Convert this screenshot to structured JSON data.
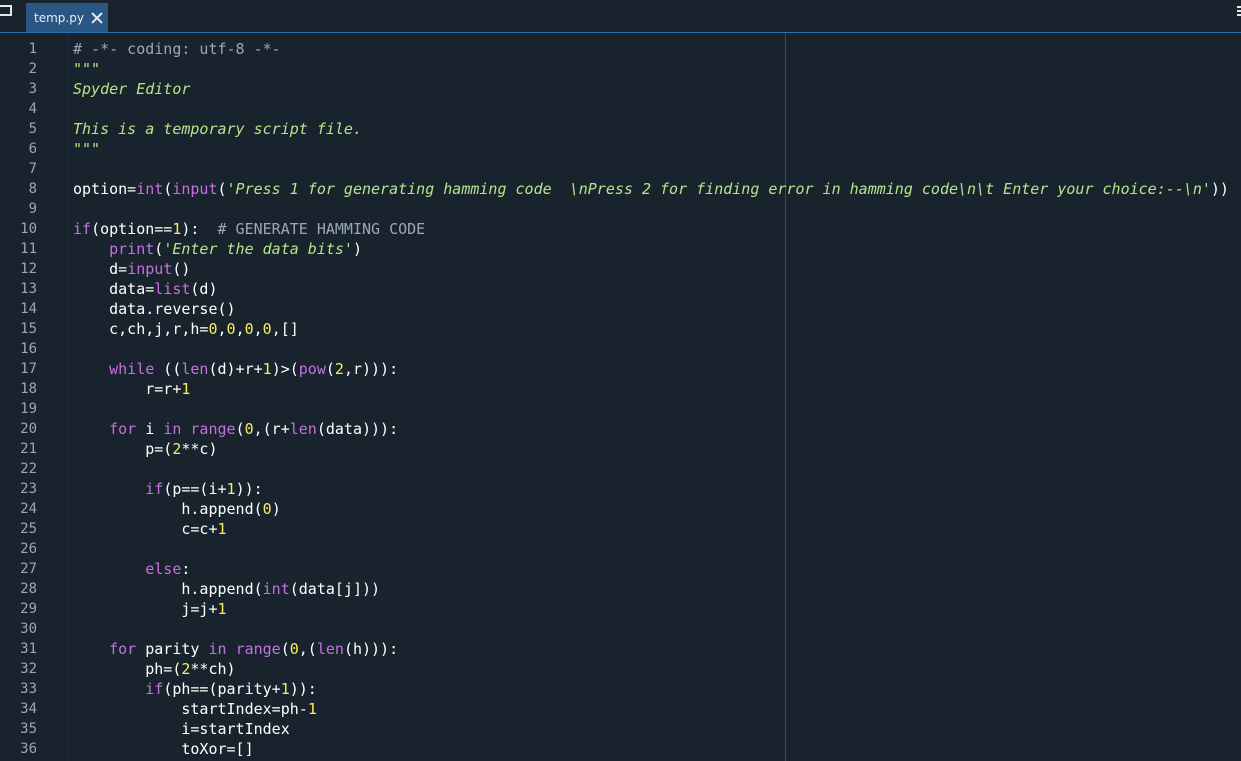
{
  "tab": {
    "filename": "temp.py"
  },
  "icons": {
    "close": "close-icon",
    "browse_tabs": "browse-tabs-icon",
    "options": "options-menu-icon"
  },
  "colors": {
    "background": "#19232d",
    "tab_active": "#2a5684",
    "accent_line": "#2a6fb0",
    "comment": "#9aa8b5",
    "string": "#b5e58c",
    "keyword": "#c670e0",
    "number": "#faed5c",
    "text": "#ffffff"
  },
  "lines": [
    {
      "n": "1",
      "tokens": [
        [
          "comment",
          "# -*- coding: utf-8 -*-"
        ]
      ]
    },
    {
      "n": "2",
      "tokens": [
        [
          "string",
          "\"\"\""
        ]
      ]
    },
    {
      "n": "3",
      "tokens": [
        [
          "string",
          "Spyder Editor"
        ]
      ]
    },
    {
      "n": "4",
      "tokens": []
    },
    {
      "n": "5",
      "tokens": [
        [
          "string",
          "This is a temporary script file."
        ]
      ]
    },
    {
      "n": "6",
      "tokens": [
        [
          "string",
          "\"\"\""
        ]
      ]
    },
    {
      "n": "7",
      "tokens": []
    },
    {
      "n": "8",
      "tokens": [
        [
          "plain",
          "option="
        ],
        [
          "builtin",
          "int"
        ],
        [
          "plain",
          "("
        ],
        [
          "builtin",
          "input"
        ],
        [
          "plain",
          "("
        ],
        [
          "string",
          "'Press 1 for generating hamming code  \\nPress 2 for finding error in hamming code\\n\\t Enter your choice:--\\n'"
        ],
        [
          "plain",
          "))"
        ]
      ]
    },
    {
      "n": "9",
      "tokens": []
    },
    {
      "n": "10",
      "tokens": [
        [
          "keyword",
          "if"
        ],
        [
          "plain",
          "(option=="
        ],
        [
          "number",
          "1"
        ],
        [
          "plain",
          "):  "
        ],
        [
          "comment",
          "# GENERATE HAMMING CODE"
        ]
      ]
    },
    {
      "n": "11",
      "tokens": [
        [
          "plain",
          "    "
        ],
        [
          "builtin",
          "print"
        ],
        [
          "plain",
          "("
        ],
        [
          "string",
          "'Enter the data bits'"
        ],
        [
          "plain",
          ")"
        ]
      ]
    },
    {
      "n": "12",
      "tokens": [
        [
          "plain",
          "    d="
        ],
        [
          "builtin",
          "input"
        ],
        [
          "plain",
          "()"
        ]
      ]
    },
    {
      "n": "13",
      "tokens": [
        [
          "plain",
          "    data="
        ],
        [
          "builtin",
          "list"
        ],
        [
          "plain",
          "(d)"
        ]
      ]
    },
    {
      "n": "14",
      "tokens": [
        [
          "plain",
          "    data.reverse()"
        ]
      ]
    },
    {
      "n": "15",
      "tokens": [
        [
          "plain",
          "    c,ch,j,r,h="
        ],
        [
          "number",
          "0"
        ],
        [
          "plain",
          ","
        ],
        [
          "number",
          "0"
        ],
        [
          "plain",
          ","
        ],
        [
          "number",
          "0"
        ],
        [
          "plain",
          ","
        ],
        [
          "number",
          "0"
        ],
        [
          "plain",
          ",[]"
        ]
      ]
    },
    {
      "n": "16",
      "tokens": []
    },
    {
      "n": "17",
      "tokens": [
        [
          "plain",
          "    "
        ],
        [
          "keyword",
          "while"
        ],
        [
          "plain",
          " (("
        ],
        [
          "builtin",
          "len"
        ],
        [
          "plain",
          "(d)+r+"
        ],
        [
          "number",
          "1"
        ],
        [
          "plain",
          ")>("
        ],
        [
          "builtin",
          "pow"
        ],
        [
          "plain",
          "("
        ],
        [
          "number",
          "2"
        ],
        [
          "plain",
          ",r))):"
        ]
      ]
    },
    {
      "n": "18",
      "tokens": [
        [
          "plain",
          "        r=r+"
        ],
        [
          "number",
          "1"
        ]
      ]
    },
    {
      "n": "19",
      "tokens": []
    },
    {
      "n": "20",
      "tokens": [
        [
          "plain",
          "    "
        ],
        [
          "keyword",
          "for"
        ],
        [
          "plain",
          " i "
        ],
        [
          "keyword",
          "in"
        ],
        [
          "plain",
          " "
        ],
        [
          "builtin",
          "range"
        ],
        [
          "plain",
          "("
        ],
        [
          "number",
          "0"
        ],
        [
          "plain",
          ",(r+"
        ],
        [
          "builtin",
          "len"
        ],
        [
          "plain",
          "(data))):"
        ]
      ]
    },
    {
      "n": "21",
      "tokens": [
        [
          "plain",
          "        p=("
        ],
        [
          "number",
          "2"
        ],
        [
          "plain",
          "**c)"
        ]
      ]
    },
    {
      "n": "22",
      "tokens": []
    },
    {
      "n": "23",
      "tokens": [
        [
          "plain",
          "        "
        ],
        [
          "keyword",
          "if"
        ],
        [
          "plain",
          "(p==(i+"
        ],
        [
          "number",
          "1"
        ],
        [
          "plain",
          ")):"
        ]
      ]
    },
    {
      "n": "24",
      "tokens": [
        [
          "plain",
          "            h.append("
        ],
        [
          "number",
          "0"
        ],
        [
          "plain",
          ")"
        ]
      ]
    },
    {
      "n": "25",
      "tokens": [
        [
          "plain",
          "            c=c+"
        ],
        [
          "number",
          "1"
        ]
      ]
    },
    {
      "n": "26",
      "tokens": []
    },
    {
      "n": "27",
      "tokens": [
        [
          "plain",
          "        "
        ],
        [
          "keyword",
          "else"
        ],
        [
          "plain",
          ":"
        ]
      ]
    },
    {
      "n": "28",
      "tokens": [
        [
          "plain",
          "            h.append("
        ],
        [
          "builtin",
          "int"
        ],
        [
          "plain",
          "(data[j]))"
        ]
      ]
    },
    {
      "n": "29",
      "tokens": [
        [
          "plain",
          "            j=j+"
        ],
        [
          "number",
          "1"
        ]
      ]
    },
    {
      "n": "30",
      "tokens": []
    },
    {
      "n": "31",
      "tokens": [
        [
          "plain",
          "    "
        ],
        [
          "keyword",
          "for"
        ],
        [
          "plain",
          " parity "
        ],
        [
          "keyword",
          "in"
        ],
        [
          "plain",
          " "
        ],
        [
          "builtin",
          "range"
        ],
        [
          "plain",
          "("
        ],
        [
          "number",
          "0"
        ],
        [
          "plain",
          ",("
        ],
        [
          "builtin",
          "len"
        ],
        [
          "plain",
          "(h))):"
        ]
      ]
    },
    {
      "n": "32",
      "tokens": [
        [
          "plain",
          "        ph=("
        ],
        [
          "number",
          "2"
        ],
        [
          "plain",
          "**ch)"
        ]
      ]
    },
    {
      "n": "33",
      "tokens": [
        [
          "plain",
          "        "
        ],
        [
          "keyword",
          "if"
        ],
        [
          "plain",
          "(ph==(parity+"
        ],
        [
          "number",
          "1"
        ],
        [
          "plain",
          ")):"
        ]
      ]
    },
    {
      "n": "34",
      "tokens": [
        [
          "plain",
          "            startIndex=ph-"
        ],
        [
          "number",
          "1"
        ]
      ]
    },
    {
      "n": "35",
      "tokens": [
        [
          "plain",
          "            i=startIndex"
        ]
      ]
    },
    {
      "n": "36",
      "tokens": [
        [
          "plain",
          "            toXor=[]"
        ]
      ]
    }
  ]
}
